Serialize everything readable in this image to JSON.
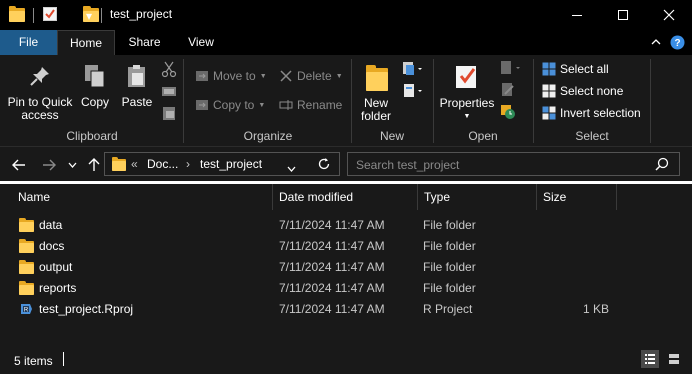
{
  "window": {
    "title": "test_project",
    "qat_dropdown": "▾"
  },
  "ribbon_tabs": [
    {
      "label": "File"
    },
    {
      "label": "Home"
    },
    {
      "label": "Share"
    },
    {
      "label": "View"
    }
  ],
  "ribbon": {
    "clipboard": {
      "pin_line1": "Pin to Quick",
      "pin_line2": "access",
      "copy": "Copy",
      "paste": "Paste",
      "group": "Clipboard"
    },
    "organize": {
      "move_to": "Move to",
      "copy_to": "Copy to",
      "delete": "Delete",
      "rename": "Rename",
      "group": "Organize"
    },
    "new": {
      "new_folder_line1": "New",
      "new_folder_line2": "folder",
      "group": "New"
    },
    "open": {
      "properties": "Properties",
      "group": "Open"
    },
    "select": {
      "select_all": "Select all",
      "select_none": "Select none",
      "invert_selection": "Invert selection",
      "group": "Select"
    }
  },
  "address": {
    "overflow": "«",
    "crumbs": [
      "Doc...",
      "test_project"
    ],
    "search_placeholder": "Search test_project"
  },
  "columns": [
    "Name",
    "Date modified",
    "Type",
    "Size"
  ],
  "files": [
    {
      "name": "data",
      "date": "7/11/2024 11:47 AM",
      "type": "File folder",
      "size": "",
      "icon": "folder-icon"
    },
    {
      "name": "docs",
      "date": "7/11/2024 11:47 AM",
      "type": "File folder",
      "size": "",
      "icon": "folder-icon"
    },
    {
      "name": "output",
      "date": "7/11/2024 11:47 AM",
      "type": "File folder",
      "size": "",
      "icon": "folder-icon"
    },
    {
      "name": "reports",
      "date": "7/11/2024 11:47 AM",
      "type": "File folder",
      "size": "",
      "icon": "folder-icon"
    },
    {
      "name": "test_project.Rproj",
      "date": "7/11/2024 11:47 AM",
      "type": "R Project",
      "size": "1 KB",
      "icon": "rproj-file-icon"
    }
  ],
  "status": {
    "item_count": "5 items"
  },
  "colors": {
    "accent_file_tab": "#1e5b8c",
    "folder_yellow": "#ffd05c",
    "background": "#191919"
  }
}
